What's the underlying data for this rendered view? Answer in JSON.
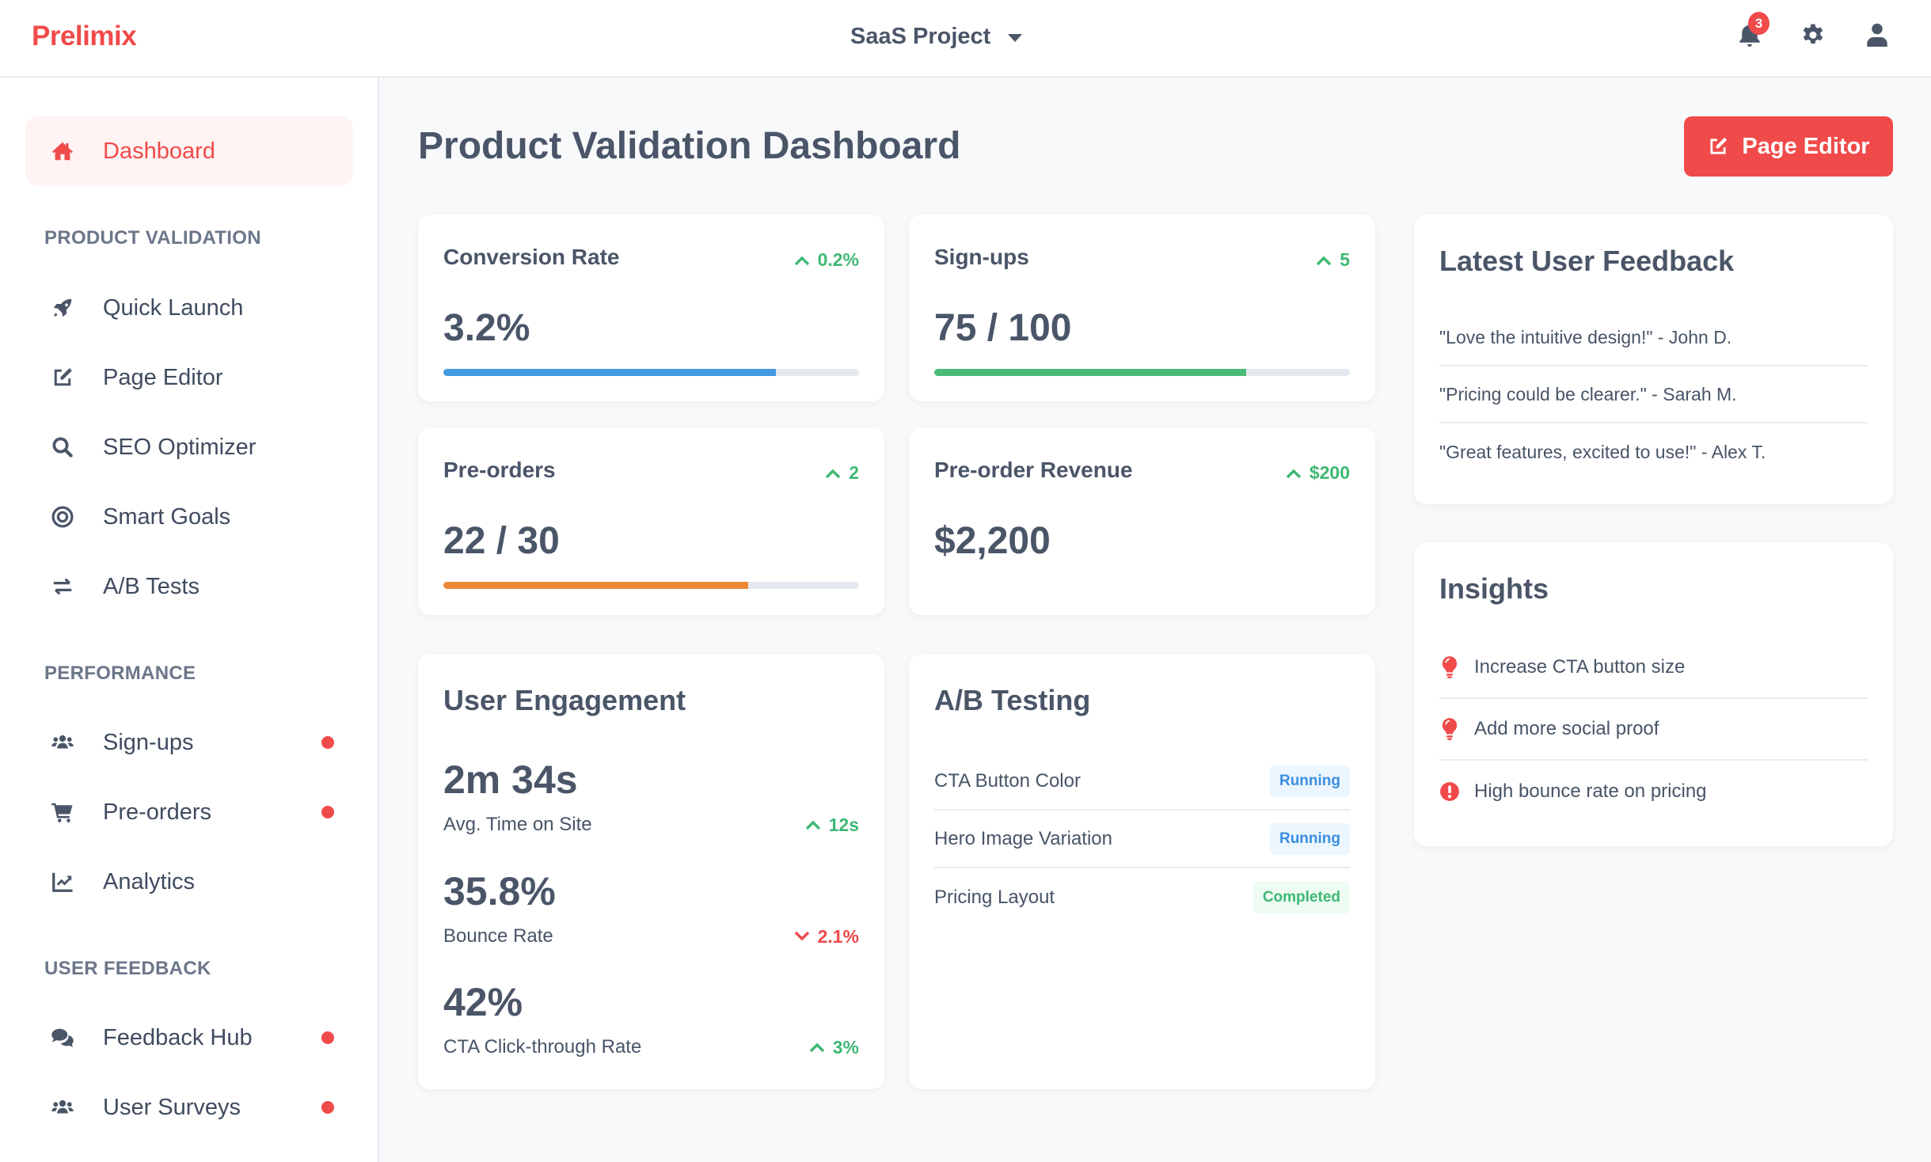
{
  "header": {
    "logo": "Prelimix",
    "project_selector": "SaaS Project",
    "notification_count": "3",
    "brand_color": "#f04a4a"
  },
  "sidebar": {
    "active_item": {
      "label": "Dashboard",
      "icon": "home-icon"
    },
    "sections": [
      {
        "title": "PRODUCT VALIDATION",
        "items": [
          {
            "label": "Quick Launch",
            "icon": "rocket-icon",
            "dot": false
          },
          {
            "label": "Page Editor",
            "icon": "edit-icon",
            "dot": false
          },
          {
            "label": "SEO Optimizer",
            "icon": "search-icon",
            "dot": false
          },
          {
            "label": "Smart Goals",
            "icon": "target-icon",
            "dot": false
          },
          {
            "label": "A/B Tests",
            "icon": "exchange-icon",
            "dot": false
          }
        ]
      },
      {
        "title": "PERFORMANCE",
        "items": [
          {
            "label": "Sign-ups",
            "icon": "users-icon",
            "dot": true
          },
          {
            "label": "Pre-orders",
            "icon": "cart-icon",
            "dot": true
          },
          {
            "label": "Analytics",
            "icon": "chart-line-icon",
            "dot": false
          }
        ]
      },
      {
        "title": "USER FEEDBACK",
        "items": [
          {
            "label": "Feedback Hub",
            "icon": "comments-icon",
            "dot": true
          },
          {
            "label": "User Surveys",
            "icon": "users-icon",
            "dot": true
          }
        ]
      }
    ]
  },
  "main": {
    "title": "Product Validation Dashboard",
    "page_editor_button": "Page Editor",
    "stats": [
      {
        "title": "Conversion Rate",
        "value": "3.2%",
        "delta": "0.2%",
        "direction": "up",
        "progress": 0.8,
        "bar_color": "#4299e1"
      },
      {
        "title": "Sign-ups",
        "value": "75 / 100",
        "delta": "5",
        "direction": "up",
        "progress": 0.75,
        "bar_color": "#48bb78"
      },
      {
        "title": "Pre-orders",
        "value": "22 / 30",
        "delta": "2",
        "direction": "up",
        "progress": 0.733,
        "bar_color": "#ed8936"
      },
      {
        "title": "Pre-order Revenue",
        "value": "$2,200",
        "delta": "$200",
        "direction": "up",
        "progress": null
      }
    ],
    "engagement": {
      "title": "User Engagement",
      "metrics": [
        {
          "value": "2m 34s",
          "label": "Avg. Time on Site",
          "delta": "12s",
          "direction": "up"
        },
        {
          "value": "35.8%",
          "label": "Bounce Rate",
          "delta": "2.1%",
          "direction": "down"
        },
        {
          "value": "42%",
          "label": "CTA Click-through Rate",
          "delta": "3%",
          "direction": "up"
        }
      ]
    },
    "ab_testing": {
      "title": "A/B Testing",
      "tests": [
        {
          "name": "CTA Button Color",
          "status": "Running"
        },
        {
          "name": "Hero Image Variation",
          "status": "Running"
        },
        {
          "name": "Pricing Layout",
          "status": "Completed"
        }
      ]
    },
    "feedback": {
      "title": "Latest User Feedback",
      "items": [
        "\"Love the intuitive design!\" - John D.",
        "\"Pricing could be clearer.\" - Sarah M.",
        "\"Great features, excited to use!\" - Alex T."
      ]
    },
    "insights": {
      "title": "Insights",
      "items": [
        {
          "text": "Increase CTA button size",
          "icon": "lightbulb-icon"
        },
        {
          "text": "Add more social proof",
          "icon": "lightbulb-icon"
        },
        {
          "text": "High bounce rate on pricing",
          "icon": "exclamation-circle-icon"
        }
      ]
    }
  }
}
